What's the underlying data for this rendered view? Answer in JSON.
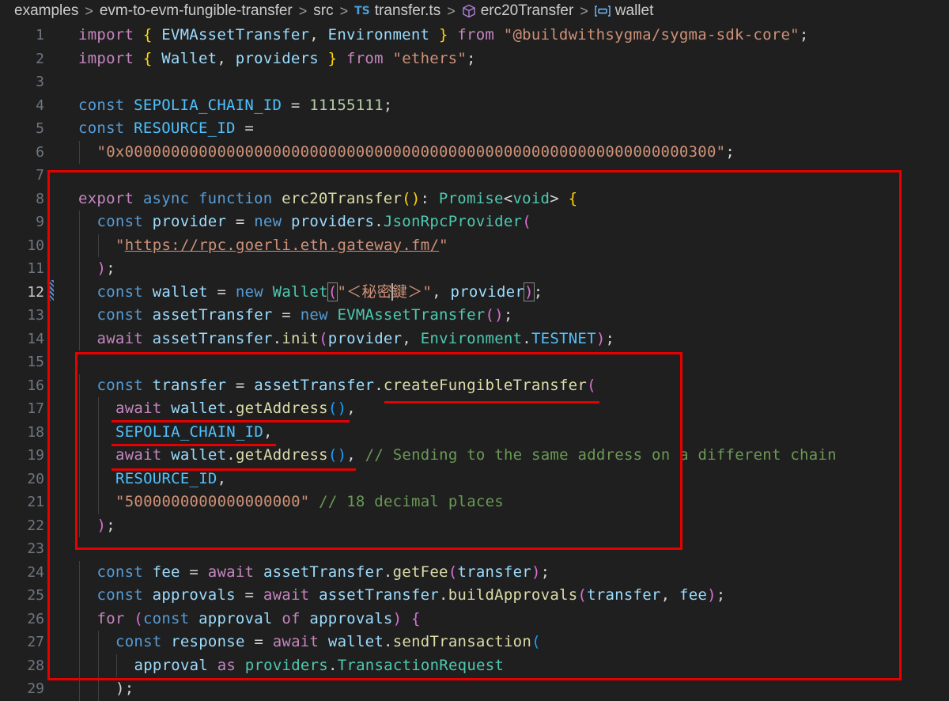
{
  "breadcrumb": {
    "items": [
      "examples",
      "evm-to-evm-fungible-transfer",
      "src",
      "transfer.ts",
      "erc20Transfer",
      "wallet"
    ],
    "separator": ">",
    "ts_badge": "TS"
  },
  "editor": {
    "active_line": 12,
    "lines": [
      {
        "n": "1",
        "indent": 0,
        "tokens": [
          [
            "import ",
            "ctl"
          ],
          [
            "{",
            "br1"
          ],
          [
            " EVMAssetTransfer",
            "var"
          ],
          [
            ", ",
            "op"
          ],
          [
            "Environment",
            "var"
          ],
          [
            " ",
            "op"
          ],
          [
            "}",
            "br1"
          ],
          [
            " from ",
            "ctl"
          ],
          [
            "\"@buildwithsygma/sygma-sdk-core\"",
            "str"
          ],
          [
            ";",
            "op"
          ]
        ]
      },
      {
        "n": "2",
        "indent": 0,
        "tokens": [
          [
            "import ",
            "ctl"
          ],
          [
            "{",
            "br1"
          ],
          [
            " Wallet",
            "var"
          ],
          [
            ", ",
            "op"
          ],
          [
            "providers",
            "var"
          ],
          [
            " ",
            "op"
          ],
          [
            "}",
            "br1"
          ],
          [
            " from ",
            "ctl"
          ],
          [
            "\"ethers\"",
            "str"
          ],
          [
            ";",
            "op"
          ]
        ]
      },
      {
        "n": "3",
        "indent": 0,
        "tokens": []
      },
      {
        "n": "4",
        "indent": 0,
        "tokens": [
          [
            "const ",
            "kw"
          ],
          [
            "SEPOLIA_CHAIN_ID",
            "const"
          ],
          [
            " = ",
            "op"
          ],
          [
            "11155111",
            "num"
          ],
          [
            ";",
            "op"
          ]
        ]
      },
      {
        "n": "5",
        "indent": 0,
        "tokens": [
          [
            "const ",
            "kw"
          ],
          [
            "RESOURCE_ID",
            "const"
          ],
          [
            " =",
            "op"
          ]
        ]
      },
      {
        "n": "6",
        "indent": 1,
        "tokens": [
          [
            "\"0x0000000000000000000000000000000000000000000000000000000000000300\"",
            "str"
          ],
          [
            ";",
            "op"
          ]
        ]
      },
      {
        "n": "7",
        "indent": 0,
        "tokens": []
      },
      {
        "n": "8",
        "indent": 0,
        "tokens": [
          [
            "export ",
            "ctl"
          ],
          [
            "async ",
            "kw"
          ],
          [
            "function ",
            "kw"
          ],
          [
            "erc20Transfer",
            "fn"
          ],
          [
            "()",
            "br1"
          ],
          [
            ": ",
            "op"
          ],
          [
            "Promise",
            "cls"
          ],
          [
            "<",
            "op"
          ],
          [
            "void",
            "cls"
          ],
          [
            ">",
            "op"
          ],
          [
            " ",
            "op"
          ],
          [
            "{",
            "br1"
          ]
        ]
      },
      {
        "n": "9",
        "indent": 1,
        "tokens": [
          [
            "const ",
            "kw"
          ],
          [
            "provider",
            "var"
          ],
          [
            " = ",
            "op"
          ],
          [
            "new ",
            "kw"
          ],
          [
            "providers",
            "var"
          ],
          [
            ".",
            "op"
          ],
          [
            "JsonRpcProvider",
            "cls"
          ],
          [
            "(",
            "br2"
          ]
        ]
      },
      {
        "n": "10",
        "indent": 2,
        "tokens": [
          [
            "\"",
            "str"
          ],
          [
            "https://rpc.goerli.eth.gateway.fm/",
            "link"
          ],
          [
            "\"",
            "str"
          ]
        ]
      },
      {
        "n": "11",
        "indent": 1,
        "tokens": [
          [
            ")",
            "br2"
          ],
          [
            ";",
            "op"
          ]
        ]
      },
      {
        "n": "12",
        "indent": 1,
        "tokens": [
          [
            "const ",
            "kw"
          ],
          [
            "wallet",
            "var"
          ],
          [
            " = ",
            "op"
          ],
          [
            "new ",
            "kw"
          ],
          [
            "Wallet",
            "cls"
          ],
          [
            "(",
            "br2hl"
          ],
          [
            "\"＜秘密",
            "str"
          ],
          [
            "|",
            "cursor"
          ],
          [
            "鍵＞\"",
            "str"
          ],
          [
            ", ",
            "op"
          ],
          [
            "provider",
            "var"
          ],
          [
            ")",
            "br2hl"
          ],
          [
            ";",
            "op"
          ]
        ]
      },
      {
        "n": "13",
        "indent": 1,
        "tokens": [
          [
            "const ",
            "kw"
          ],
          [
            "assetTransfer",
            "var"
          ],
          [
            " = ",
            "op"
          ],
          [
            "new ",
            "kw"
          ],
          [
            "EVMAssetTransfer",
            "cls"
          ],
          [
            "()",
            "br2"
          ],
          [
            ";",
            "op"
          ]
        ]
      },
      {
        "n": "14",
        "indent": 1,
        "tokens": [
          [
            "await ",
            "ctl"
          ],
          [
            "assetTransfer",
            "var"
          ],
          [
            ".",
            "op"
          ],
          [
            "init",
            "fn"
          ],
          [
            "(",
            "br2"
          ],
          [
            "provider",
            "var"
          ],
          [
            ", ",
            "op"
          ],
          [
            "Environment",
            "cls"
          ],
          [
            ".",
            "op"
          ],
          [
            "TESTNET",
            "const"
          ],
          [
            ")",
            "br2"
          ],
          [
            ";",
            "op"
          ]
        ]
      },
      {
        "n": "15",
        "indent": 0,
        "tokens": []
      },
      {
        "n": "16",
        "indent": 1,
        "tokens": [
          [
            "const ",
            "kw"
          ],
          [
            "transfer",
            "var"
          ],
          [
            " = ",
            "op"
          ],
          [
            "assetTransfer",
            "var"
          ],
          [
            ".",
            "op"
          ],
          [
            "createFungibleTransfer",
            "fn"
          ],
          [
            "(",
            "br2"
          ]
        ]
      },
      {
        "n": "17",
        "indent": 2,
        "tokens": [
          [
            "await ",
            "ctl"
          ],
          [
            "wallet",
            "var"
          ],
          [
            ".",
            "op"
          ],
          [
            "getAddress",
            "fn"
          ],
          [
            "()",
            "br3"
          ],
          [
            ",",
            "op"
          ]
        ]
      },
      {
        "n": "18",
        "indent": 2,
        "tokens": [
          [
            "SEPOLIA_CHAIN_ID",
            "const"
          ],
          [
            ",",
            "op"
          ]
        ]
      },
      {
        "n": "19",
        "indent": 2,
        "tokens": [
          [
            "await ",
            "ctl"
          ],
          [
            "wallet",
            "var"
          ],
          [
            ".",
            "op"
          ],
          [
            "getAddress",
            "fn"
          ],
          [
            "()",
            "br3"
          ],
          [
            ", ",
            "op"
          ],
          [
            "// Sending to the same address on a different chain",
            "com"
          ]
        ]
      },
      {
        "n": "20",
        "indent": 2,
        "tokens": [
          [
            "RESOURCE_ID",
            "const"
          ],
          [
            ",",
            "op"
          ]
        ]
      },
      {
        "n": "21",
        "indent": 2,
        "tokens": [
          [
            "\"5000000000000000000\"",
            "str"
          ],
          [
            " ",
            "op"
          ],
          [
            "// 18 decimal places",
            "com"
          ]
        ]
      },
      {
        "n": "22",
        "indent": 1,
        "tokens": [
          [
            ")",
            "br2"
          ],
          [
            ";",
            "op"
          ]
        ]
      },
      {
        "n": "23",
        "indent": 0,
        "tokens": []
      },
      {
        "n": "24",
        "indent": 1,
        "tokens": [
          [
            "const ",
            "kw"
          ],
          [
            "fee",
            "var"
          ],
          [
            " = ",
            "op"
          ],
          [
            "await ",
            "ctl"
          ],
          [
            "assetTransfer",
            "var"
          ],
          [
            ".",
            "op"
          ],
          [
            "getFee",
            "fn"
          ],
          [
            "(",
            "br2"
          ],
          [
            "transfer",
            "var"
          ],
          [
            ")",
            "br2"
          ],
          [
            ";",
            "op"
          ]
        ]
      },
      {
        "n": "25",
        "indent": 1,
        "tokens": [
          [
            "const ",
            "kw"
          ],
          [
            "approvals",
            "var"
          ],
          [
            " = ",
            "op"
          ],
          [
            "await ",
            "ctl"
          ],
          [
            "assetTransfer",
            "var"
          ],
          [
            ".",
            "op"
          ],
          [
            "buildApprovals",
            "fn"
          ],
          [
            "(",
            "br2"
          ],
          [
            "transfer",
            "var"
          ],
          [
            ", ",
            "op"
          ],
          [
            "fee",
            "var"
          ],
          [
            ")",
            "br2"
          ],
          [
            ";",
            "op"
          ]
        ]
      },
      {
        "n": "26",
        "indent": 1,
        "tokens": [
          [
            "for ",
            "ctl"
          ],
          [
            "(",
            "br2"
          ],
          [
            "const ",
            "kw"
          ],
          [
            "approval ",
            "var"
          ],
          [
            "of ",
            "ctl"
          ],
          [
            "approvals",
            "var"
          ],
          [
            ")",
            "br2"
          ],
          [
            " ",
            "op"
          ],
          [
            "{",
            "br2"
          ]
        ]
      },
      {
        "n": "27",
        "indent": 2,
        "tokens": [
          [
            "const ",
            "kw"
          ],
          [
            "response",
            "var"
          ],
          [
            " = ",
            "op"
          ],
          [
            "await ",
            "ctl"
          ],
          [
            "wallet",
            "var"
          ],
          [
            ".",
            "op"
          ],
          [
            "sendTransaction",
            "fn"
          ],
          [
            "(",
            "br3"
          ]
        ]
      },
      {
        "n": "28",
        "indent": 3,
        "tokens": [
          [
            "approval ",
            "var"
          ],
          [
            "as ",
            "ctl"
          ],
          [
            "providers",
            "cls"
          ],
          [
            ".",
            "op"
          ],
          [
            "TransactionRequest",
            "cls"
          ]
        ]
      },
      {
        "n": "29",
        "indent": 2,
        "tokens": [
          [
            ");",
            "op"
          ]
        ]
      }
    ]
  }
}
